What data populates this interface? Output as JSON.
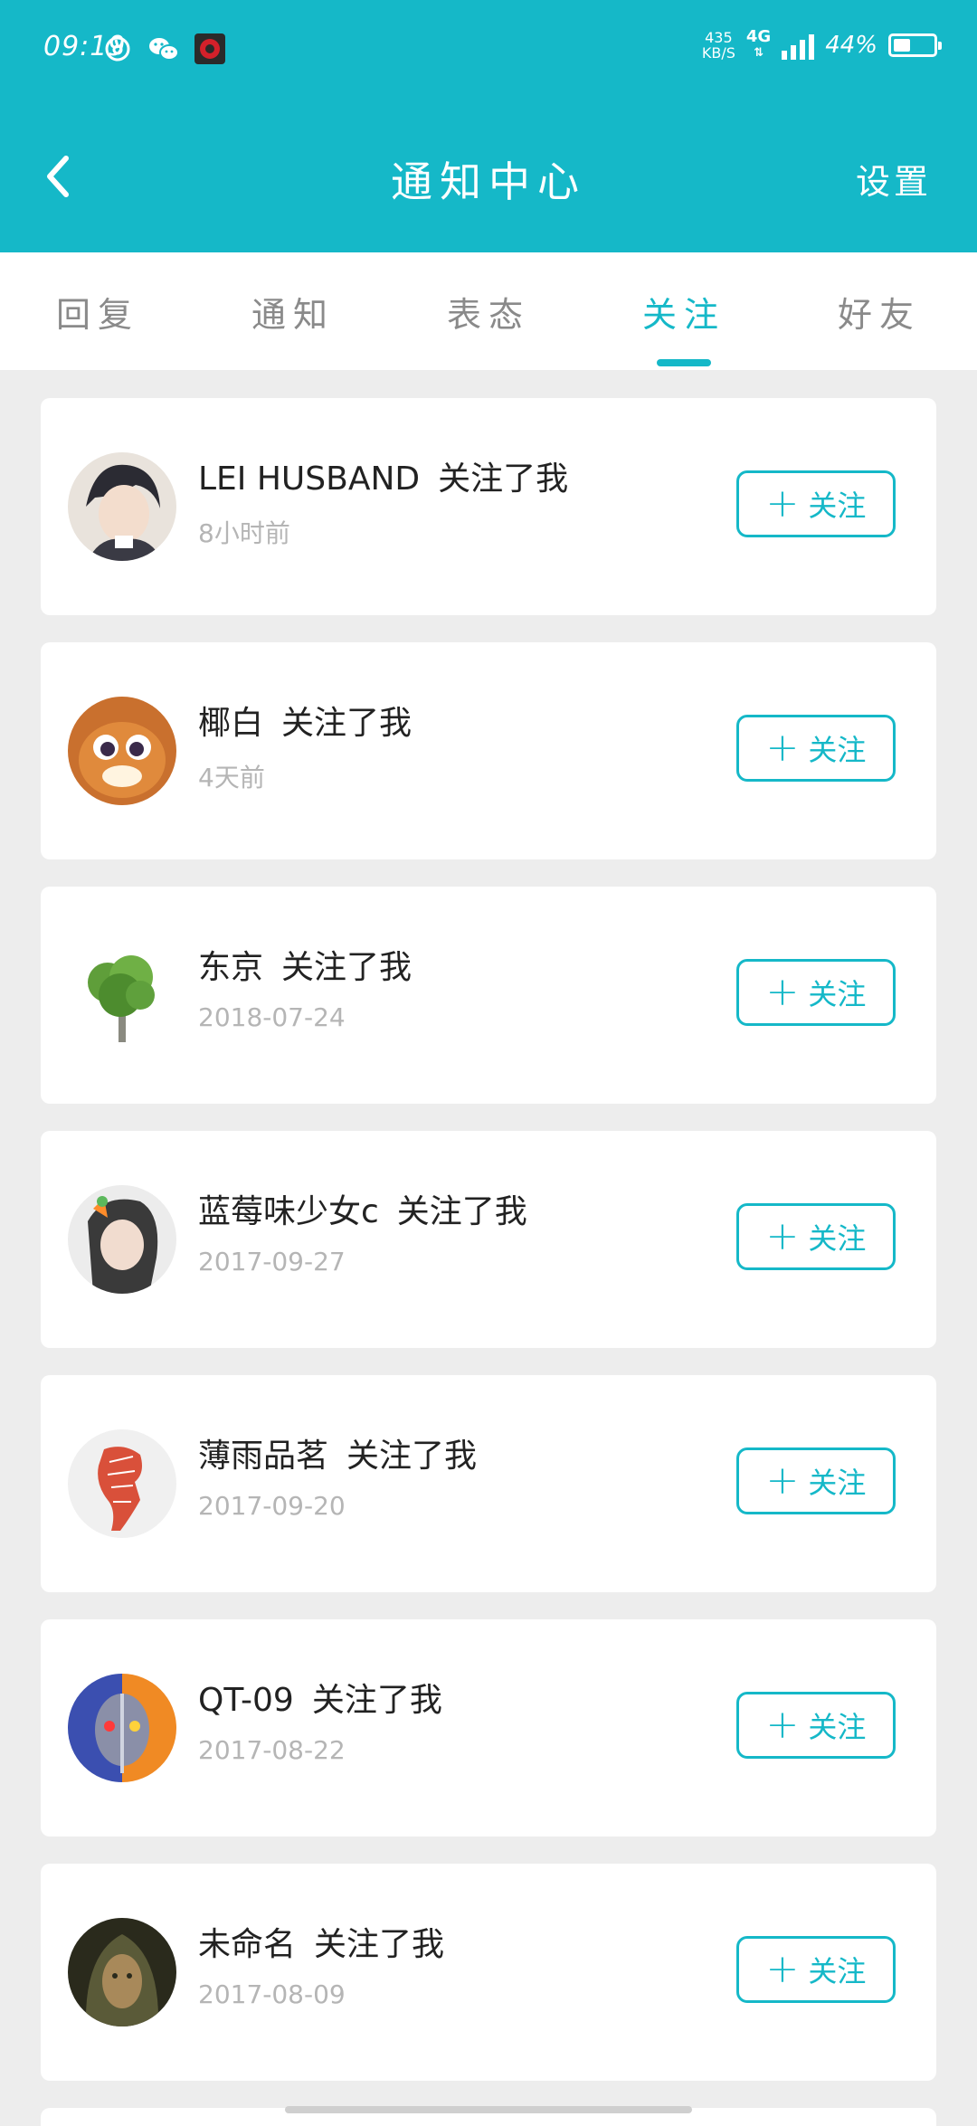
{
  "status_bar": {
    "time": "09:19",
    "net_speed_value": "435",
    "net_speed_unit": "KB/S",
    "network_type": "4G",
    "battery_percent": "44%",
    "battery_level": 0.44
  },
  "header": {
    "title": "通知中心",
    "settings_label": "设置"
  },
  "tabs": [
    {
      "label": "回复",
      "active": false
    },
    {
      "label": "通知",
      "active": false
    },
    {
      "label": "表态",
      "active": false
    },
    {
      "label": "关注",
      "active": true
    },
    {
      "label": "好友",
      "active": false
    }
  ],
  "follow_action_text": "关注了我",
  "follow_button_label": "关注",
  "notifications": [
    {
      "user": "LEI HUSBAND",
      "time": "8小时前"
    },
    {
      "user": "椰白",
      "time": "4天前"
    },
    {
      "user": "东京",
      "time": "2018-07-24"
    },
    {
      "user": "蓝莓味少女c",
      "time": "2017-09-27"
    },
    {
      "user": "薄雨品茗",
      "time": "2017-09-20"
    },
    {
      "user": "QT-09",
      "time": "2017-08-22"
    },
    {
      "user": "未命名",
      "time": "2017-08-09"
    }
  ],
  "colors": {
    "accent": "#15b8c8",
    "background": "#ededed",
    "card": "#ffffff",
    "muted_text": "#b5b5b5"
  }
}
